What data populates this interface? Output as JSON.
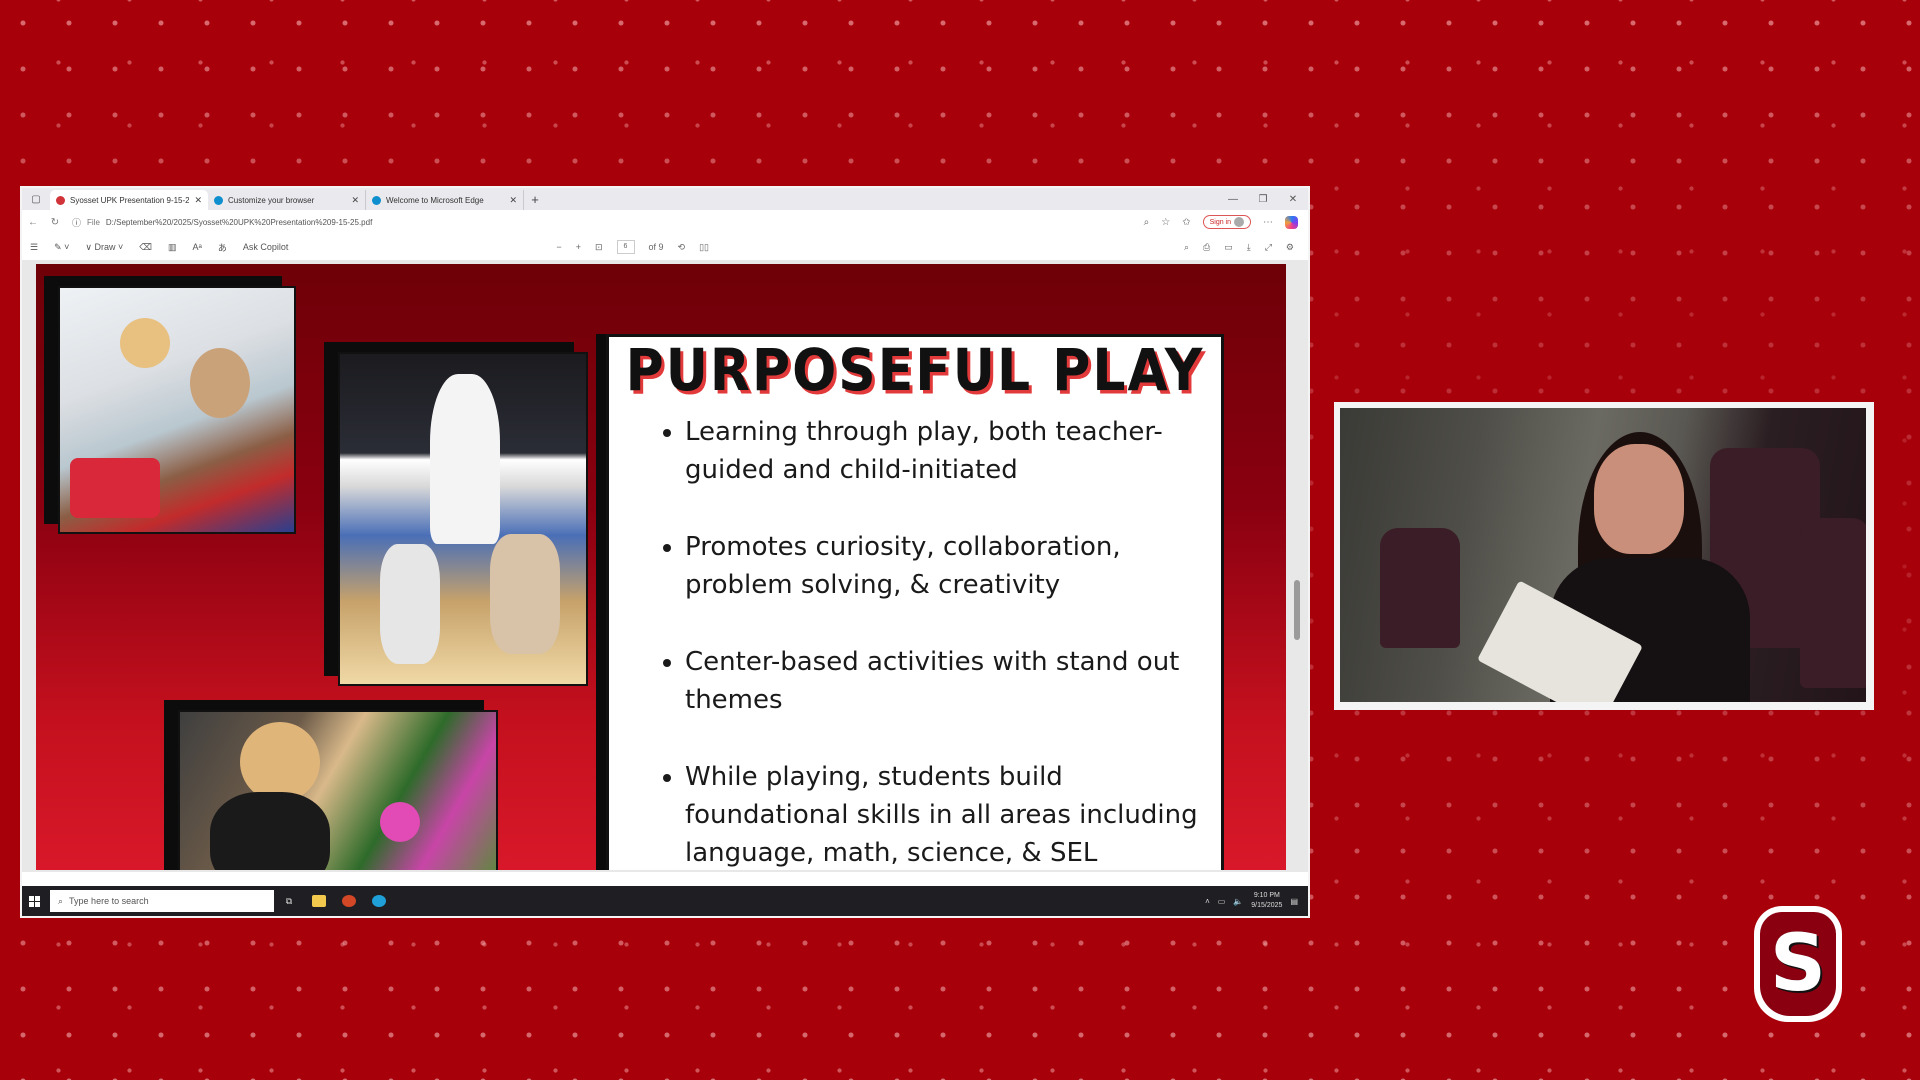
{
  "browser": {
    "tabs": [
      {
        "label": "Syosset UPK Presentation 9-15-2",
        "active": true,
        "favicon_color": "#d13438"
      },
      {
        "label": "Customize your browser",
        "active": false,
        "favicon_color": "#0f8fce"
      },
      {
        "label": "Welcome to Microsoft Edge",
        "active": false,
        "favicon_color": "#0f8fce"
      }
    ],
    "new_tab": "+",
    "address": {
      "file_label": "File",
      "url": "D:/September%20/2025/Syosset%20UPK%20Presentation%209-15-25.pdf"
    },
    "signin_label": "Sign in"
  },
  "pdf_toolbar": {
    "draw_label": "Draw",
    "ask_copilot_label": "Ask Copilot",
    "page_current": "6",
    "page_total": "of 9"
  },
  "slide": {
    "title": "PURPOSEFUL PLAY",
    "bullets": [
      "Learning through play, both teacher-guided and child-initiated",
      "Promotes curiosity, collaboration, problem solving, & creativity",
      "Center-based activities with stand out themes",
      "While playing, students build foundational skills in all areas including language, math, science, & SEL"
    ]
  },
  "taskbar": {
    "search_placeholder": "Type here to search",
    "time": "9:10 PM",
    "date": "9/15/2025"
  },
  "logo": {
    "letter": "S"
  },
  "colors": {
    "background": "#a8000a",
    "slide_dark": "#6e0008",
    "accent": "#e23a3a"
  }
}
